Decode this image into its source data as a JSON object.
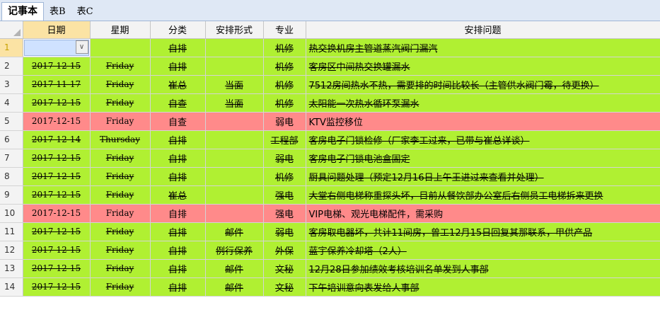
{
  "tabs": [
    "记事本",
    "表B",
    "表C"
  ],
  "columns": [
    "日期",
    "星期",
    "分类",
    "安排形式",
    "专业",
    "安排问题"
  ],
  "dropdown_icon": "chevron-down-icon",
  "colors": {
    "done": "#b0f032",
    "pending": "#ff8a8a",
    "selected_header": "#fbe3a4"
  },
  "rows": [
    {
      "num": "1",
      "date": "",
      "week": "",
      "cat": "自排",
      "form": "",
      "dept": "机修",
      "issue": "热交换机房主管道蒸汽阀门漏汽",
      "status": "done"
    },
    {
      "num": "2",
      "date": "2017-12-15",
      "week": "Friday",
      "cat": "自排",
      "form": "",
      "dept": "机修",
      "issue": "客房区中间热交换罐漏水",
      "status": "done"
    },
    {
      "num": "3",
      "date": "2017-11-17",
      "week": "Friday",
      "cat": "崔总",
      "form": "当面",
      "dept": "机修",
      "issue": "7512房间热水不热，需要排的时间比较长（主管供水阀门霉，待更换）",
      "status": "done"
    },
    {
      "num": "4",
      "date": "2017-12-15",
      "week": "Friday",
      "cat": "自查",
      "form": "当面",
      "dept": "机修",
      "issue": "太阳能一次热水循环泵漏水",
      "status": "done"
    },
    {
      "num": "5",
      "date": "2017-12-15",
      "week": "Friday",
      "cat": "自查",
      "form": "",
      "dept": "弱电",
      "issue": "KTV监控移位",
      "status": "pending"
    },
    {
      "num": "6",
      "date": "2017-12-14",
      "week": "Thursday",
      "cat": "自排",
      "form": "",
      "dept": "工程部",
      "issue": "客房电子门锁检修（厂家李工过来，已带与崔总详谈）",
      "status": "done"
    },
    {
      "num": "7",
      "date": "2017-12-15",
      "week": "Friday",
      "cat": "自排",
      "form": "",
      "dept": "弱电",
      "issue": "客房电子门锁电池盒固定",
      "status": "done"
    },
    {
      "num": "8",
      "date": "2017-12-15",
      "week": "Friday",
      "cat": "自排",
      "form": "",
      "dept": "机修",
      "issue": "厨具问题处理（预定12月16日上午王进过来查看并处理）",
      "status": "done"
    },
    {
      "num": "9",
      "date": "2017-12-15",
      "week": "Friday",
      "cat": "崔总",
      "form": "",
      "dept": "强电",
      "issue": "大堂右侧电梯称重探头坏，目前从餐饮部办公室后右侧员工电梯拆来更换",
      "status": "done"
    },
    {
      "num": "10",
      "date": "2017-12-15",
      "week": "Friday",
      "cat": "自排",
      "form": "",
      "dept": "强电",
      "issue": "VIP电梯、观光电梯配件，需采购",
      "status": "pending"
    },
    {
      "num": "11",
      "date": "2017-12-15",
      "week": "Friday",
      "cat": "自排",
      "form": "邮件",
      "dept": "弱电",
      "issue": "客房取电器坏，共计11间房，曾工12月15日回复其那联系，甲供产品",
      "status": "done"
    },
    {
      "num": "12",
      "date": "2017-12-15",
      "week": "Friday",
      "cat": "自排",
      "form": "例行保养",
      "dept": "外保",
      "issue": "蓝宇保养冷却塔（2人）",
      "status": "done"
    },
    {
      "num": "13",
      "date": "2017-12-15",
      "week": "Friday",
      "cat": "自排",
      "form": "邮件",
      "dept": "文秘",
      "issue": "12月28日参加绩效考核培训名单发到人事部",
      "status": "done"
    },
    {
      "num": "14",
      "date": "2017-12-15",
      "week": "Friday",
      "cat": "自排",
      "form": "邮件",
      "dept": "文秘",
      "issue": "下午培训意向表发给人事部",
      "status": "done"
    }
  ]
}
